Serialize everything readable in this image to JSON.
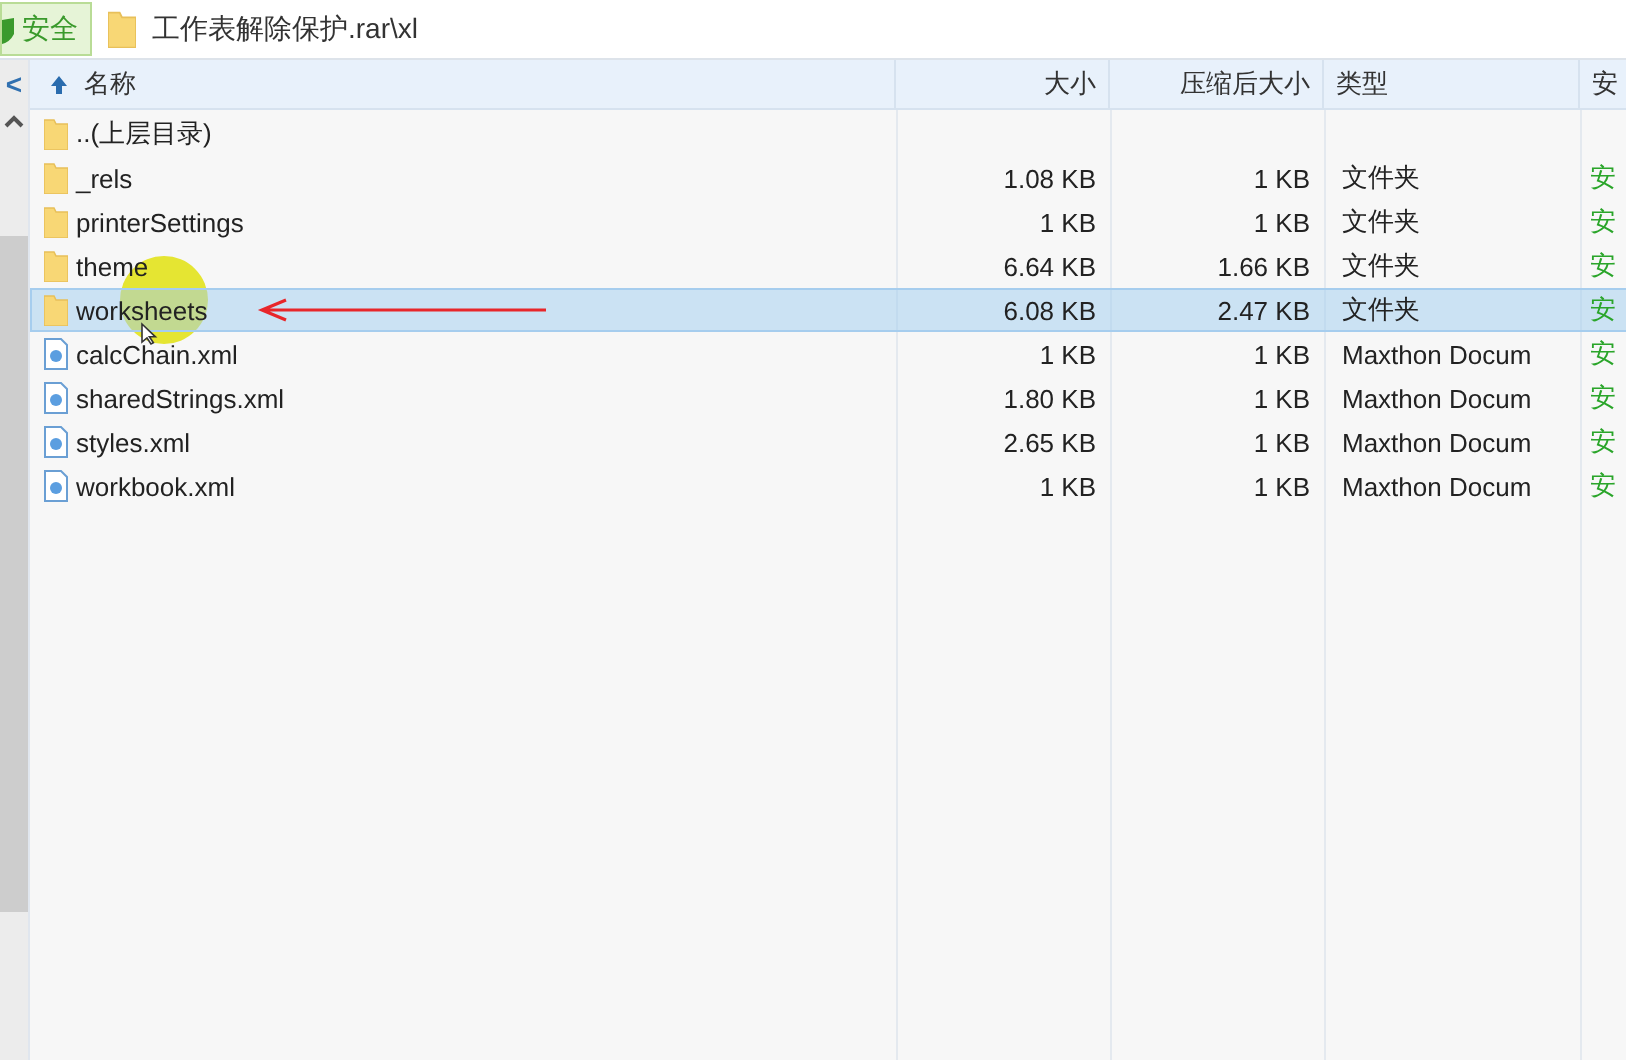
{
  "address_bar": {
    "badge": "安全",
    "path": "工作表解除保护.rar\\xl"
  },
  "nav": {
    "back": "<"
  },
  "table": {
    "columns": [
      {
        "label": "名称",
        "sorted": true
      },
      {
        "label": "大小"
      },
      {
        "label": "压缩后大小"
      },
      {
        "label": "类型"
      },
      {
        "label": "安"
      }
    ],
    "rows": [
      {
        "kind": "parent",
        "name": "..(上层目录)",
        "selected": false
      },
      {
        "kind": "folder",
        "name": "_rels",
        "size": "1.08 KB",
        "packed": "1 KB",
        "type": "文件夹",
        "security": "安",
        "selected": false
      },
      {
        "kind": "folder",
        "name": "printerSettings",
        "size": "1 KB",
        "packed": "1 KB",
        "type": "文件夹",
        "security": "安",
        "selected": false
      },
      {
        "kind": "folder",
        "name": "theme",
        "size": "6.64 KB",
        "packed": "1.66 KB",
        "type": "文件夹",
        "security": "安",
        "selected": false
      },
      {
        "kind": "folder",
        "name": "worksheets",
        "size": "6.08 KB",
        "packed": "2.47 KB",
        "type": "文件夹",
        "security": "安",
        "selected": true,
        "annotated": true
      },
      {
        "kind": "file",
        "name": "calcChain.xml",
        "size": "1 KB",
        "packed": "1 KB",
        "type": "Maxthon Docum",
        "security": "安",
        "selected": false
      },
      {
        "kind": "file",
        "name": "sharedStrings.xml",
        "size": "1.80 KB",
        "packed": "1 KB",
        "type": "Maxthon Docum",
        "security": "安",
        "selected": false
      },
      {
        "kind": "file",
        "name": "styles.xml",
        "size": "2.65 KB",
        "packed": "1 KB",
        "type": "Maxthon Docum",
        "security": "安",
        "selected": false
      },
      {
        "kind": "file",
        "name": "workbook.xml",
        "size": "1 KB",
        "packed": "1 KB",
        "type": "Maxthon Docum",
        "security": "安",
        "selected": false
      }
    ]
  }
}
